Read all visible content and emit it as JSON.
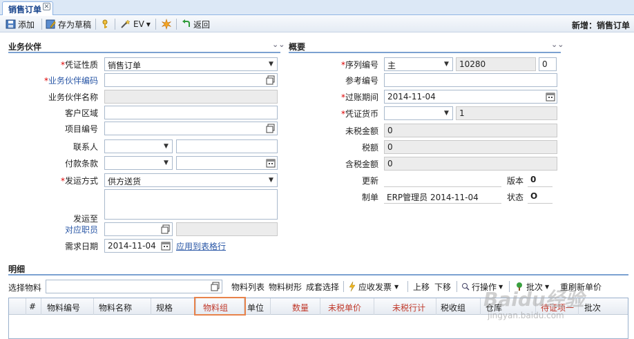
{
  "tab": {
    "label": "销售订单",
    "close": "×"
  },
  "toolbar": {
    "add": "添加",
    "save_draft": "存为草稿",
    "ev": "EV",
    "back": "返回",
    "mode_title": "新增：销售订单"
  },
  "partner": {
    "title": "业务伙伴",
    "voucher_type_label": "凭证性质",
    "voucher_type_value": "销售订单",
    "partner_code_label": "业务伙伴编码",
    "partner_name_label": "业务伙伴名称",
    "region_label": "客户区域",
    "project_label": "项目编号",
    "contact_label": "联系人",
    "payment_label": "付款条款",
    "ship_method_label": "发运方式",
    "ship_method_value": "供方送货",
    "ship_to_label": "发运至",
    "employee_label": "对应职员",
    "req_date_label": "需求日期",
    "req_date_value": "2014-11-04",
    "apply_link": "应用到表格行"
  },
  "summary": {
    "title": "概要",
    "serial_label": "序列编号",
    "serial_prefix": "主",
    "serial_number": "10280",
    "serial_suffix": "0",
    "ref_label": "参考编号",
    "post_date_label": "过账期间",
    "post_date_value": "2014-11-04",
    "currency_label": "凭证货币",
    "currency_rate": "1",
    "net_label": "未税金额",
    "net_value": "0",
    "tax_label": "税额",
    "tax_value": "0",
    "gross_label": "含税金额",
    "gross_value": "0",
    "update_label": "更新",
    "version_label": "版本",
    "version_value": "0",
    "creator_label": "制单",
    "creator_value": "ERP管理员 2014-11-04",
    "status_label": "状态",
    "status_value": "O"
  },
  "detail": {
    "title": "明细",
    "select_material_label": "选择物料",
    "tools": [
      "物料列表",
      "物料树形",
      "成套选择"
    ],
    "invoice": "应收发票",
    "move_up": "上移",
    "move_down": "下移",
    "row_ops": "行操作",
    "batch": "批次",
    "refresh_price": "重刷新单价",
    "columns": [
      "#",
      "物料编号",
      "物料名称",
      "规格",
      "物料组",
      "单位",
      "数量",
      "未税单价",
      "未税行计",
      "税收组",
      "仓库",
      "待证项一",
      "批次"
    ]
  },
  "watermark": {
    "brand": "Baidu经验",
    "url": "jingyan.baidu.com"
  },
  "colors": {
    "accent": "#15428b",
    "required": "#dd0000",
    "link": "#2a57a6",
    "highlight": "#e8824a"
  }
}
